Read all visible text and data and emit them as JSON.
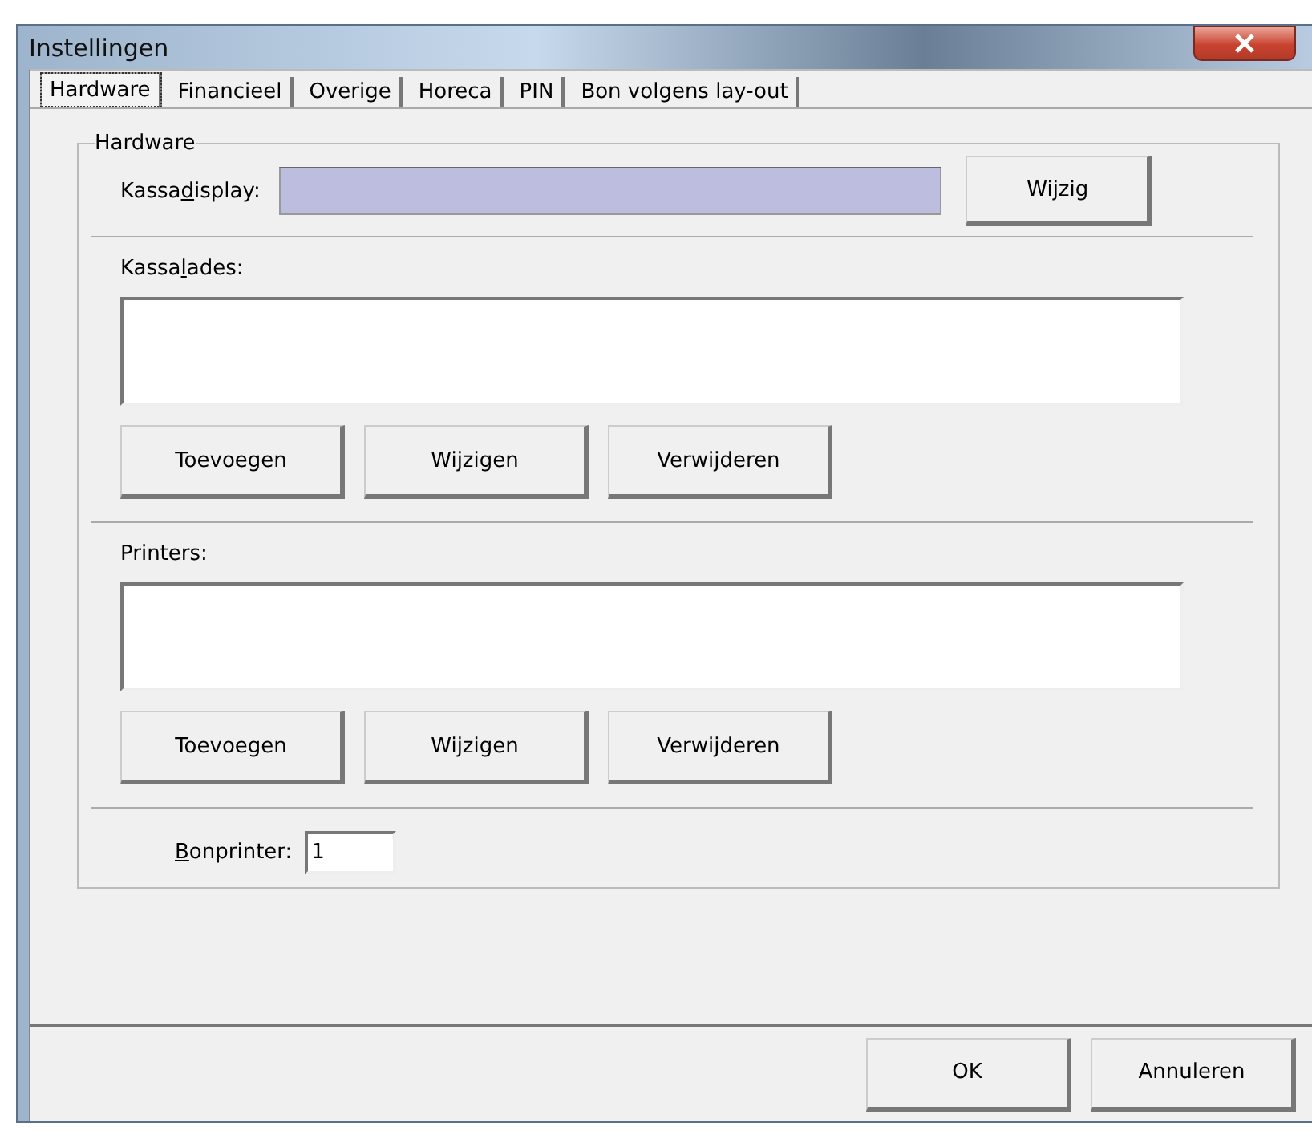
{
  "window": {
    "title": "Instellingen"
  },
  "tabs": [
    {
      "label": "Hardware",
      "selected": true
    },
    {
      "label": "Financieel",
      "selected": false
    },
    {
      "label": "Overige",
      "selected": false
    },
    {
      "label": "Horeca",
      "selected": false
    },
    {
      "label": "PIN",
      "selected": false
    },
    {
      "label": "Bon volgens lay-out",
      "selected": false
    }
  ],
  "group": {
    "title": "Hardware",
    "display": {
      "label_before": "Kassa",
      "access_key": "d",
      "label_after": "isplay:",
      "button": "Wijzig"
    },
    "lists": [
      {
        "label_before": "Kassa",
        "access_key": "l",
        "label_after": "ades:",
        "buttons": [
          "Toevoegen",
          "Wijzigen",
          "Verwijderen"
        ]
      },
      {
        "label_before": "Printers:",
        "buttons": [
          "Toevoegen",
          "Wijzigen",
          "Verwijderen"
        ]
      }
    ],
    "bonprinter": {
      "access_key": "B",
      "label_after": "onprinter:",
      "value": "1"
    }
  },
  "buttons": [
    "OK",
    "Annuleren"
  ]
}
